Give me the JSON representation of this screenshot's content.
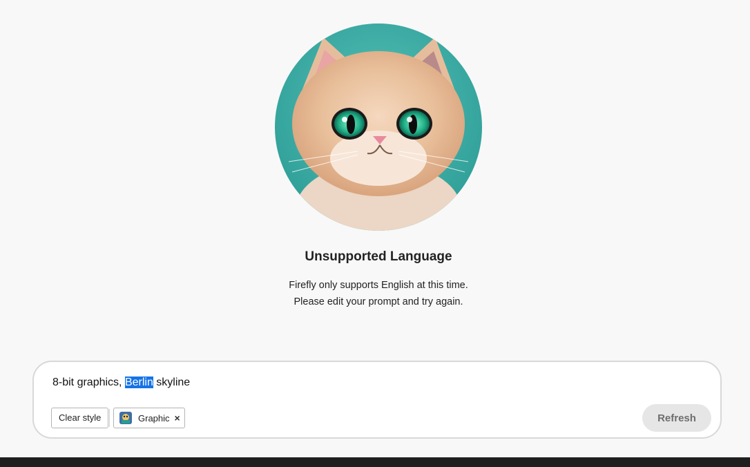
{
  "error": {
    "title": "Unsupported Language",
    "line1": "Firefly only supports English at this time.",
    "line2": "Please edit your prompt and try again."
  },
  "prompt": {
    "before": "8-bit graphics, ",
    "selected": "Berlin",
    "after": " skyline"
  },
  "controls": {
    "clear_style_label": "Clear style",
    "style_chip_label": "Graphic",
    "style_chip_close": "×",
    "refresh_label": "Refresh"
  },
  "colors": {
    "selection": "#1473e6",
    "background": "#f8f8f8",
    "illustration_bg": "#3aa9a3"
  },
  "icons": {
    "illustration": "cat-illustration",
    "chip_thumbnail": "graphic-style-thumbnail-icon",
    "chip_close": "close-icon"
  }
}
